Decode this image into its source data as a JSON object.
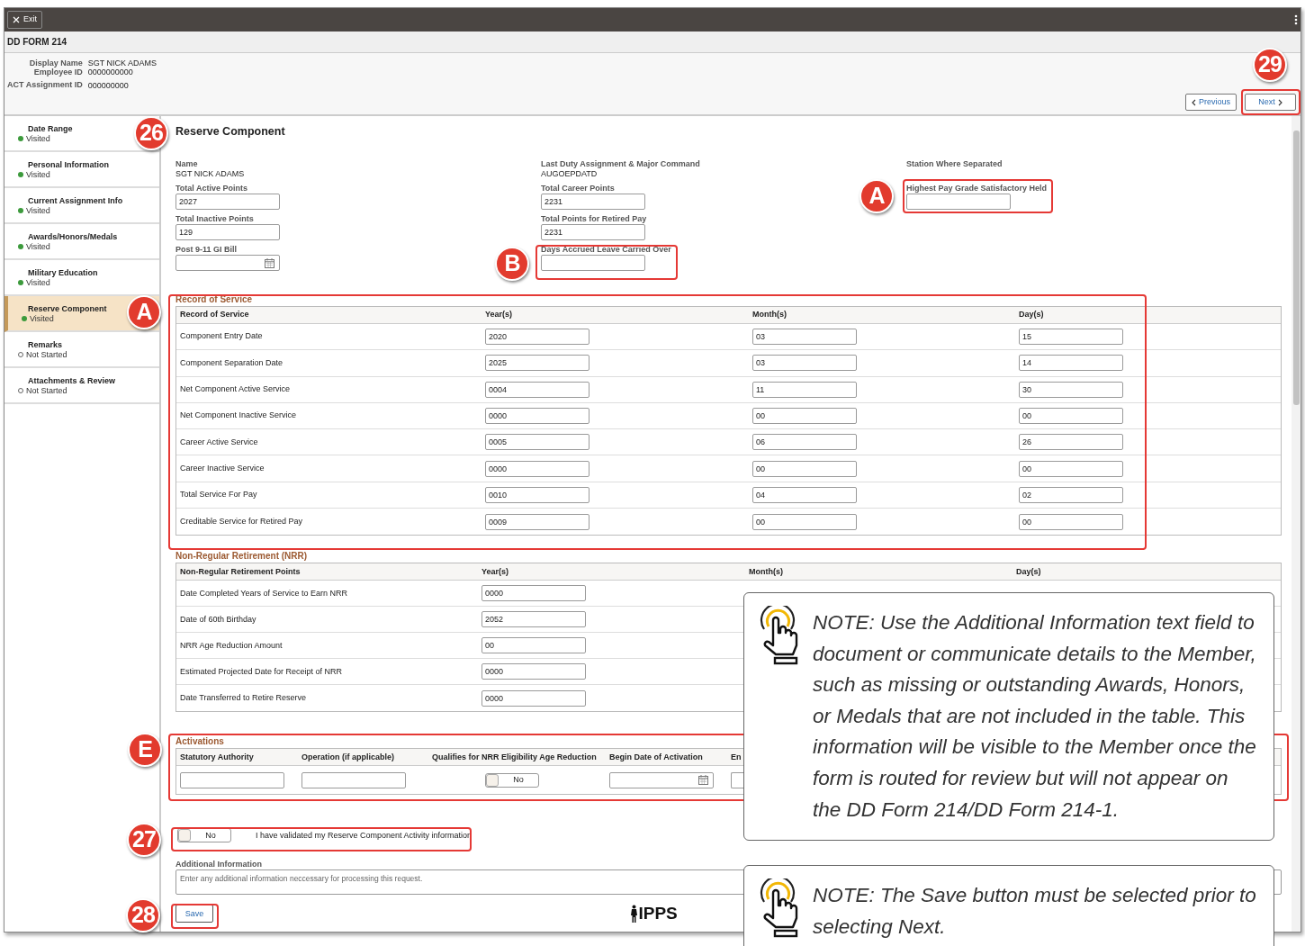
{
  "toolbar": {
    "exit_label": "Exit"
  },
  "form_title": "DD FORM 214",
  "employee": [
    {
      "label": "Display Name",
      "value": "SGT NICK ADAMS"
    },
    {
      "label": "Employee ID",
      "value": "0000000000"
    },
    {
      "label": "ACT Assignment ID",
      "value": "000000000"
    }
  ],
  "nav_buttons": [
    {
      "label": "Previous",
      "kind": "previous"
    },
    {
      "label": "Next",
      "kind": "next"
    }
  ],
  "sidebar": {
    "items": [
      {
        "title": "Date Range",
        "status": "Visited",
        "visited": true,
        "selected": false
      },
      {
        "title": "Personal Information",
        "status": "Visited",
        "visited": true,
        "selected": false
      },
      {
        "title": "Current Assignment Info",
        "status": "Visited",
        "visited": true,
        "selected": false
      },
      {
        "title": "Awards/Honors/Medals",
        "status": "Visited",
        "visited": true,
        "selected": false
      },
      {
        "title": "Military Education",
        "status": "Visited",
        "visited": true,
        "selected": false
      },
      {
        "title": "Reserve Component",
        "status": "Visited",
        "visited": true,
        "selected": true
      },
      {
        "title": "Remarks",
        "status": "Not Started",
        "visited": false,
        "selected": false
      },
      {
        "title": "Attachments & Review",
        "status": "Not Started",
        "visited": false,
        "selected": false
      }
    ]
  },
  "section_title": "Reserve Component",
  "field_columns": [
    [
      {
        "label": "Name",
        "kind": "display",
        "value": "SGT NICK ADAMS"
      },
      {
        "label": "Total Active Points",
        "kind": "input",
        "value": "2027"
      },
      {
        "label": "Total Inactive Points",
        "kind": "input",
        "value": "129"
      },
      {
        "label": "Post 9-11 GI Bill",
        "kind": "date"
      }
    ],
    [
      {
        "label": "Last Duty Assignment & Major Command",
        "kind": "display",
        "value": "AUGOEPDATD"
      },
      {
        "label": "Total Career Points",
        "kind": "input",
        "value": "2231"
      },
      {
        "label": "Total Points for Retired Pay",
        "kind": "input",
        "value": "2231"
      },
      {
        "label": "Days Accrued Leave Carried Over",
        "kind": "input"
      }
    ],
    [
      {
        "label": "Station Where Separated",
        "kind": "display"
      },
      {
        "label": "Highest Pay Grade Satisfactory Held",
        "kind": "input"
      }
    ]
  ],
  "record_of_service": {
    "title": "Record of Service",
    "columns": [
      "Record of Service",
      "Year(s)",
      "Month(s)",
      "Day(s)"
    ],
    "rows": [
      {
        "label": "Component Entry Date",
        "values": [
          "2020",
          "03",
          "15"
        ]
      },
      {
        "label": "Component Separation Date",
        "values": [
          "2025",
          "03",
          "14"
        ]
      },
      {
        "label": "Net Component Active Service",
        "values": [
          "0004",
          "11",
          "30"
        ]
      },
      {
        "label": "Net Component Inactive Service",
        "values": [
          "0000",
          "00",
          "00"
        ]
      },
      {
        "label": "Career Active Service",
        "values": [
          "0005",
          "06",
          "26"
        ]
      },
      {
        "label": "Career Inactive Service",
        "values": [
          "0000",
          "00",
          "00"
        ]
      },
      {
        "label": "Total Service For Pay",
        "values": [
          "0010",
          "04",
          "02"
        ]
      },
      {
        "label": "Creditable Service for Retired Pay",
        "values": [
          "0009",
          "00",
          "00"
        ]
      }
    ]
  },
  "nrr": {
    "title": "Non-Regular Retirement (NRR)",
    "columns": [
      "Non-Regular Retirement Points",
      "Year(s)",
      "Month(s)",
      "Day(s)"
    ],
    "rows": [
      {
        "label": "Date Completed Years of Service to Earn NRR",
        "values": [
          "0000"
        ]
      },
      {
        "label": "Date of 60th Birthday",
        "values": [
          "2052"
        ]
      },
      {
        "label": "NRR Age Reduction Amount",
        "values": [
          "00"
        ]
      },
      {
        "label": "Estimated Projected Date for Receipt of NRR",
        "values": [
          "0000"
        ]
      },
      {
        "label": "Date Transferred to Retire Reserve",
        "values": [
          "0000"
        ]
      }
    ]
  },
  "activations": {
    "title": "Activations",
    "columns": [
      "Statutory Authority",
      "Operation (if applicable)",
      "Qualifies for NRR Eligibility Age Reduction",
      "Begin Date of Activation",
      "En"
    ],
    "row": {
      "nrr_toggle": {
        "label": "No",
        "on": false
      }
    }
  },
  "validation": {
    "toggle": {
      "label": "No",
      "on": false
    },
    "text": "I have validated my Reserve Component Activity information"
  },
  "additional_information": {
    "label": "Additional Information",
    "placeholder": "Enter any additional information neccessary for processing this request."
  },
  "save_label": "Save",
  "logo": {
    "text": "IPPS"
  },
  "notes": [
    "NOTE: Use the Additional Information text field to document or communicate details to the Member, such as missing or outstanding Awards, Honors, or Medals that are not included in the table. This information will be visible to the Member once the form is routed for review but will not appear on the DD Form 214/DD Form 214-1.",
    "NOTE: The Save button must be selected prior to selecting Next."
  ],
  "callouts": [
    "29",
    "26",
    "A",
    "B",
    "A",
    "E",
    "27",
    "28"
  ]
}
